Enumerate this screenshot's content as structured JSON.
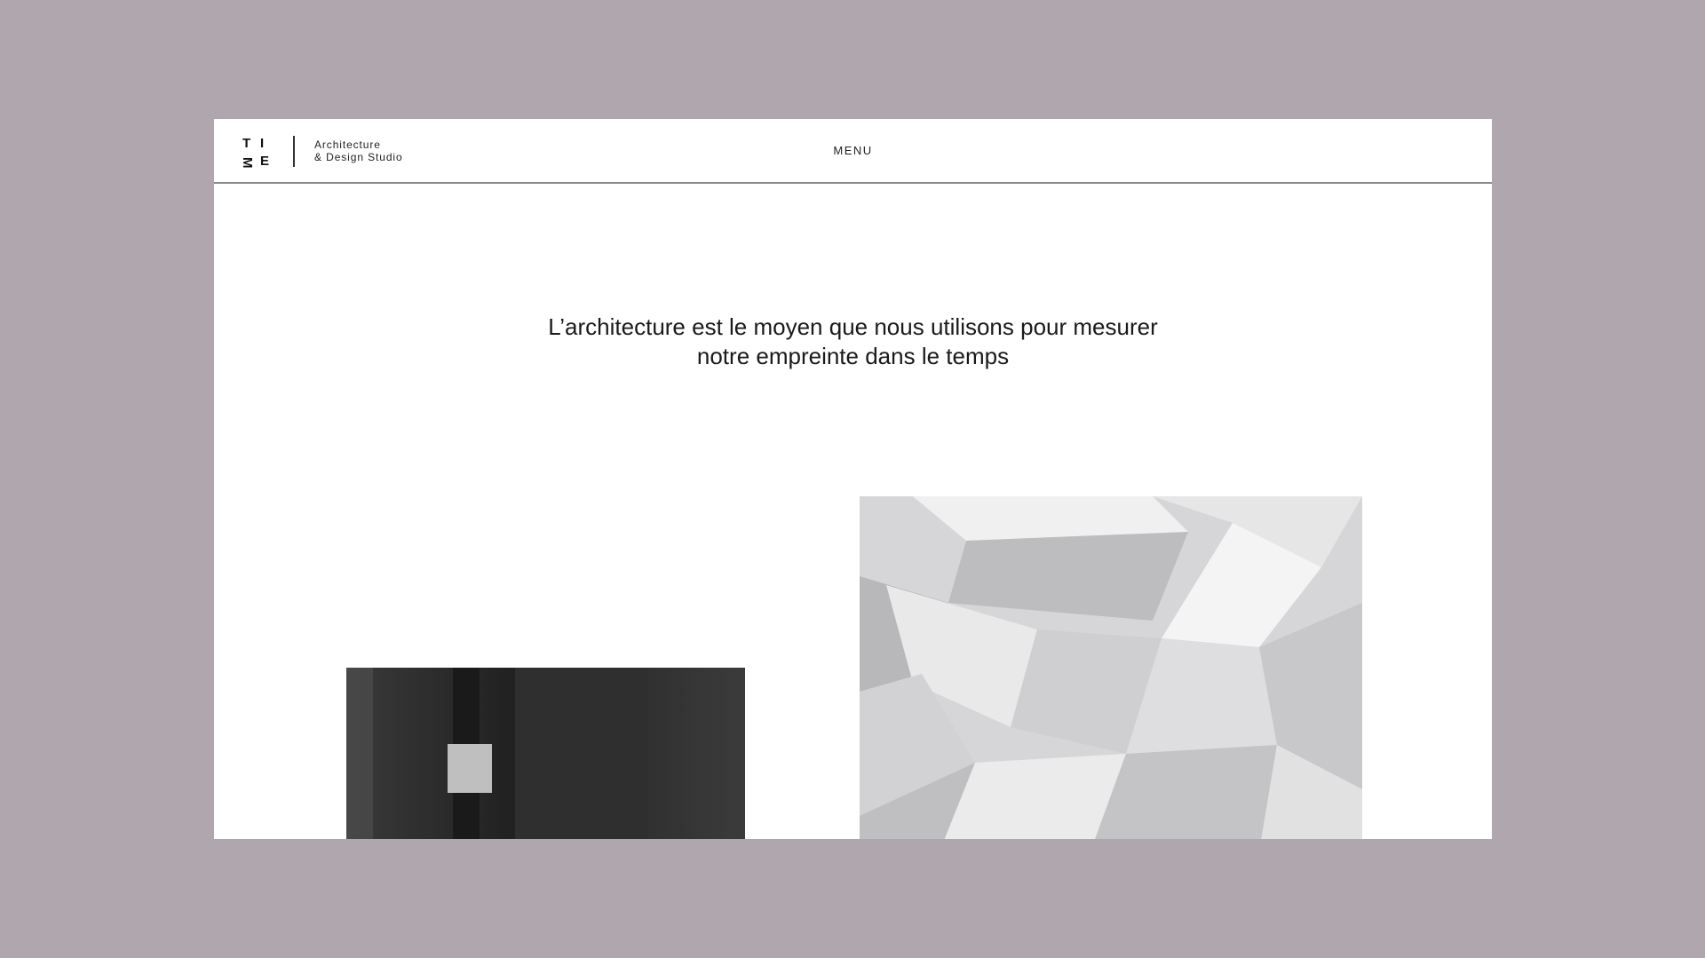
{
  "logo": {
    "letters": [
      "T",
      "I",
      "M",
      "E"
    ]
  },
  "tagline": {
    "line1": "Architecture",
    "line2": "& Design Studio"
  },
  "nav": {
    "menu_label": "MENU"
  },
  "hero": {
    "line1": "L’architecture est le moyen que nous utilisons pour mesurer",
    "line2": "notre empreinte dans le temps"
  },
  "colors": {
    "page_background": "#b0a6ae",
    "frame_background": "#ffffff",
    "text": "#1a1a1a"
  }
}
